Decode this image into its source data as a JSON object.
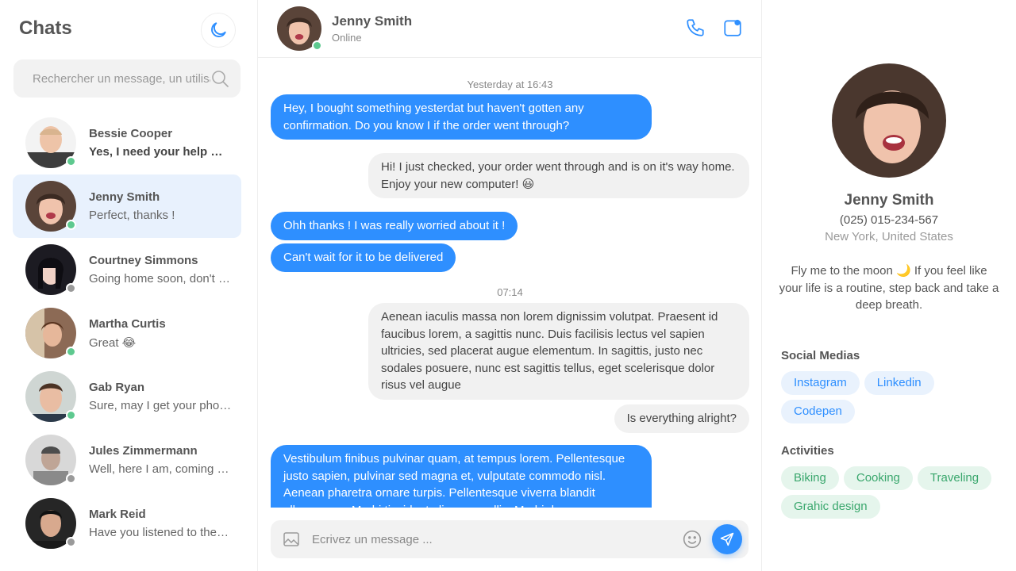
{
  "sidebar": {
    "title": "Chats",
    "search_placeholder": "Rechercher un message, un utilisateur...",
    "contacts": [
      {
        "name": "Bessie Cooper",
        "message": "Yes, I need your help with...",
        "online": true,
        "unread": true
      },
      {
        "name": "Jenny Smith",
        "message": "Perfect, thanks !",
        "online": true,
        "active": true
      },
      {
        "name": "Courtney Simmons",
        "message": "Going home soon, don't forget",
        "online": false
      },
      {
        "name": "Martha Curtis",
        "message": "Great 😂",
        "online": true
      },
      {
        "name": "Gab Ryan",
        "message": "Sure, may I get your phone number?",
        "online": true
      },
      {
        "name": "Jules Zimmermann",
        "message": "Well, here I am, coming home",
        "online": false
      },
      {
        "name": "Mark Reid",
        "message": "Have you listened to the new album?",
        "online": false
      }
    ]
  },
  "chat": {
    "name": "Jenny Smith",
    "status": "Online",
    "timestamps": [
      "Yesterday at 16:43",
      "07:14"
    ],
    "messages": [
      {
        "dir": "out",
        "text": "Hey, I bought something yesterdat but haven't gotten any confirmation. Do you know I if the order went through?"
      },
      {
        "dir": "in",
        "text": "Hi! I just checked, your order went through and is on it's way home. Enjoy your new computer! 😃"
      },
      {
        "dir": "out",
        "text": "Ohh thanks ! I was really worried about it !"
      },
      {
        "dir": "out",
        "text": "Can't wait for it to be delivered"
      },
      {
        "dir": "in",
        "text": "Aenean iaculis massa non lorem dignissim volutpat. Praesent id faucibus lorem, a sagittis nunc. Duis facilisis lectus vel sapien ultricies, sed placerat augue elementum. In sagittis, justo nec sodales posuere, nunc est sagittis tellus, eget scelerisque dolor risus vel augue"
      },
      {
        "dir": "in",
        "text": "Is everything alright?"
      },
      {
        "dir": "out",
        "text": "Vestibulum finibus pulvinar quam, at tempus lorem. Pellentesque justo sapien, pulvinar sed magna et, vulputate commodo nisl. Aenean pharetra ornare turpis. Pellentesque viverra blandit ullamcorper. Morbi tincidunt aliquam mollis. Morbi rhoncus"
      }
    ],
    "composer_placeholder": "Ecrivez un message ..."
  },
  "profile": {
    "name": "Jenny Smith",
    "phone": "(025) 015-234-567",
    "location": "New York, United States",
    "bio": "Fly me to the moon 🌙 If you feel like your life is a routine, step back and take a deep breath.",
    "social_title": "Social Medias",
    "socials": [
      "Instagram",
      "Linkedin",
      "Codepen"
    ],
    "activities_title": "Activities",
    "activities": [
      "Biking",
      "Cooking",
      "Traveling",
      "Grahic design"
    ]
  },
  "colors": {
    "accent": "#2e8fff",
    "online": "#5ec98f",
    "offline": "#9a9a9a",
    "active_row": "#e8f1fd"
  }
}
